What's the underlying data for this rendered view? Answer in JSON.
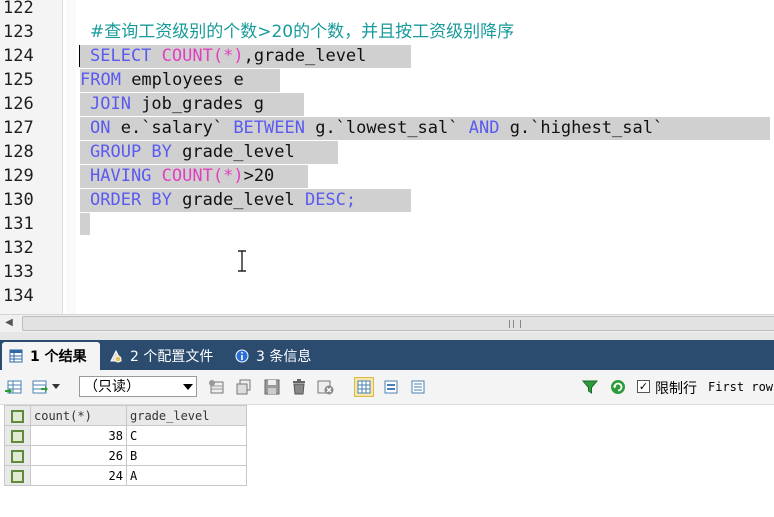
{
  "editor": {
    "line_numbers": [
      "122",
      "123",
      "124",
      "125",
      "126",
      "127",
      "128",
      "129",
      "130",
      "131",
      "132",
      "133",
      "134"
    ],
    "comment": "#查询工资级别的个数>20的个数，并且按工资级别降序",
    "line124": {
      "kw1": "SELECT",
      "fn": "COUNT",
      "p": "(*)",
      "rest": ",grade_level"
    },
    "line125": {
      "kw": "FROM",
      "rest": " employees e"
    },
    "line126": {
      "kw": "JOIN",
      "rest": " job_grades g"
    },
    "line127": {
      "kw1": "ON",
      "mid1": " e.`salary` ",
      "kw2": "BETWEEN",
      "mid2": " g.`lowest_sal` ",
      "kw3": "AND",
      "mid3": " g.`highest_sal`"
    },
    "line128": {
      "kw": "GROUP BY",
      "rest": " grade_level"
    },
    "line129": {
      "kw": "HAVING",
      "fn": "COUNT",
      "p": "(*)",
      "rest": ">20"
    },
    "line130": {
      "kw1": "ORDER BY",
      "mid": " grade_level ",
      "kw2": "DESC;"
    }
  },
  "tabs": [
    {
      "label": "1 个结果",
      "icon": "table-icon",
      "active": true
    },
    {
      "label": "2 个配置文件",
      "icon": "profile-icon",
      "active": false
    },
    {
      "label": "3 条信息",
      "icon": "info-icon",
      "active": false
    }
  ],
  "toolbar": {
    "mode_select": "（只读）",
    "limit_label": "限制行",
    "limit_checked": "✓",
    "first_row_label": "First row"
  },
  "results": {
    "columns": [
      "count(*)",
      "grade_level"
    ],
    "rows": [
      [
        "38",
        "C"
      ],
      [
        "26",
        "B"
      ],
      [
        "24",
        "A"
      ]
    ]
  },
  "scrollbar": {
    "grip": "III"
  }
}
